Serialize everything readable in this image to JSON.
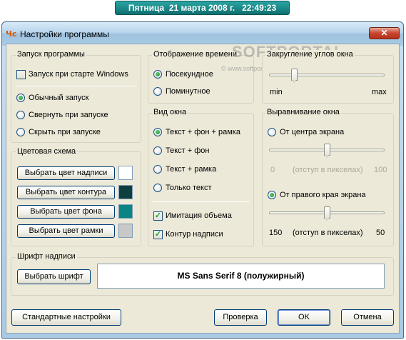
{
  "clock": "Пятница  21 марта 2008 г.   22:49:23",
  "window": {
    "icon_text": "Чс",
    "title": "Настройки программы",
    "close_glyph": "✕"
  },
  "watermark": {
    "text": "SOFTPORTAL",
    "url": "© www.softportal.com"
  },
  "startup": {
    "group_label": "Запуск программы",
    "autostart_label": "Запуск при старте Windows",
    "autostart_checked": false,
    "modes": [
      {
        "label": "Обычный запуск",
        "selected": true
      },
      {
        "label": "Свернуть при запуске",
        "selected": false
      },
      {
        "label": "Скрыть при запуске",
        "selected": false
      }
    ]
  },
  "display": {
    "group_label": "Отображение времени",
    "options": [
      {
        "label": "Посекундное",
        "selected": true
      },
      {
        "label": "Поминутное",
        "selected": false
      }
    ]
  },
  "corners": {
    "group_label": "Закругление углов окна",
    "min_label": "min",
    "max_label": "max",
    "level": 0.2
  },
  "color_scheme": {
    "group_label": "Цветовая схема",
    "buttons": [
      {
        "label": "Выбрать цвет надписи",
        "color": "#ffffff"
      },
      {
        "label": "Выбрать цвет контура",
        "color": "#0e3f3f"
      },
      {
        "label": "Выбрать цвет фона",
        "color": "#0b8484"
      },
      {
        "label": "Выбрать цвет рамки",
        "color": "#c8c8c8"
      }
    ]
  },
  "view": {
    "group_label": "Вид окна",
    "options": [
      {
        "label": "Текст + фон + рамка",
        "selected": true
      },
      {
        "label": "Текст + фон",
        "selected": false
      },
      {
        "label": "Текст + рамка",
        "selected": false
      },
      {
        "label": "Только текст",
        "selected": false
      }
    ],
    "checks": [
      {
        "label": "Имитация объема",
        "checked": true
      },
      {
        "label": "Контур надписи",
        "checked": true
      }
    ]
  },
  "align": {
    "group_label": "Выравнивание окна",
    "center": {
      "label": "От центра экрана",
      "selected": false,
      "min": "0",
      "max": "100",
      "caption": "(отступ в пикселах)",
      "level": 0.5
    },
    "right": {
      "label": "От правого края экрана",
      "selected": true,
      "min": "150",
      "max": "50",
      "caption": "(отступ в пикселах)",
      "level": 0.5
    }
  },
  "font": {
    "group_label": "Шрифт надписи",
    "button_label": "Выбрать шрифт",
    "current": "MS Sans Serif 8 (полужирный)"
  },
  "footer": {
    "defaults_label": "Стандартные настройки",
    "test_label": "Проверка",
    "ok_label": "OK",
    "cancel_label": "Отмена"
  }
}
